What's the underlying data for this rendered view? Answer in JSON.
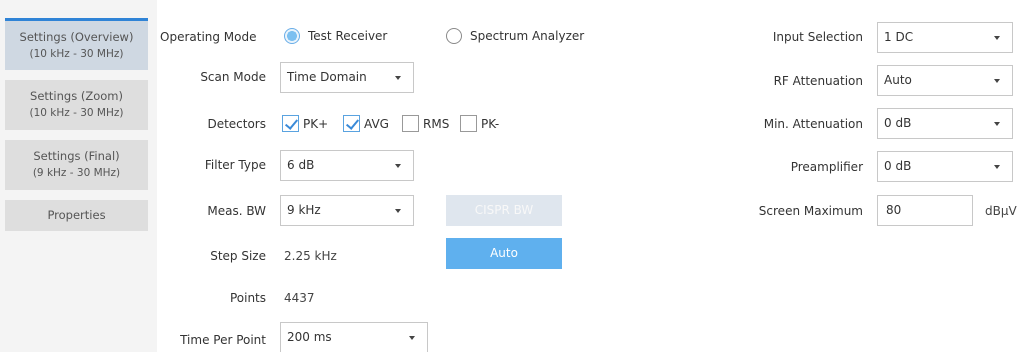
{
  "sidebar": {
    "tabs": [
      {
        "title": "Settings (Overview)",
        "sub": "(10 kHz - 30 MHz)"
      },
      {
        "title": "Settings (Zoom)",
        "sub": "(10 kHz - 30 MHz)"
      },
      {
        "title": "Settings (Final)",
        "sub": "(9 kHz - 30 MHz)"
      },
      {
        "title": "Properties",
        "sub": ""
      }
    ]
  },
  "left": {
    "operating_mode": {
      "label": "Operating Mode",
      "options": [
        "Test Receiver",
        "Spectrum Analyzer"
      ],
      "selected": "Test Receiver"
    },
    "scan_mode": {
      "label": "Scan Mode",
      "value": "Time Domain"
    },
    "detectors": {
      "label": "Detectors",
      "items": [
        {
          "label": "PK+",
          "checked": true
        },
        {
          "label": "AVG",
          "checked": true
        },
        {
          "label": "RMS",
          "checked": false
        },
        {
          "label": "PK-",
          "checked": false
        }
      ]
    },
    "filter_type": {
      "label": "Filter Type",
      "value": "6 dB"
    },
    "meas_bw": {
      "label": "Meas. BW",
      "value": "9 kHz",
      "cispr_button": "CISPR BW"
    },
    "step_size": {
      "label": "Step Size",
      "value": "2.25 kHz",
      "auto_button": "Auto"
    },
    "points": {
      "label": "Points",
      "value": "4437"
    },
    "time_per_point": {
      "label": "Time Per Point",
      "value": "200 ms"
    }
  },
  "right": {
    "input_selection": {
      "label": "Input Selection",
      "value": "1 DC"
    },
    "rf_attenuation": {
      "label": "RF Attenuation",
      "value": "Auto"
    },
    "min_attenuation": {
      "label": "Min. Attenuation",
      "value": "0 dB"
    },
    "preamplifier": {
      "label": "Preamplifier",
      "value": "0 dB"
    },
    "screen_maximum": {
      "label": "Screen Maximum",
      "value": "80",
      "unit": "dBµV"
    }
  },
  "colors": {
    "accent": "#2f83d6",
    "primary_button": "#5fb0ee",
    "disabled_button": "#dfe6ee",
    "active_tab": "#cfd8e2",
    "tab": "#dedede"
  }
}
